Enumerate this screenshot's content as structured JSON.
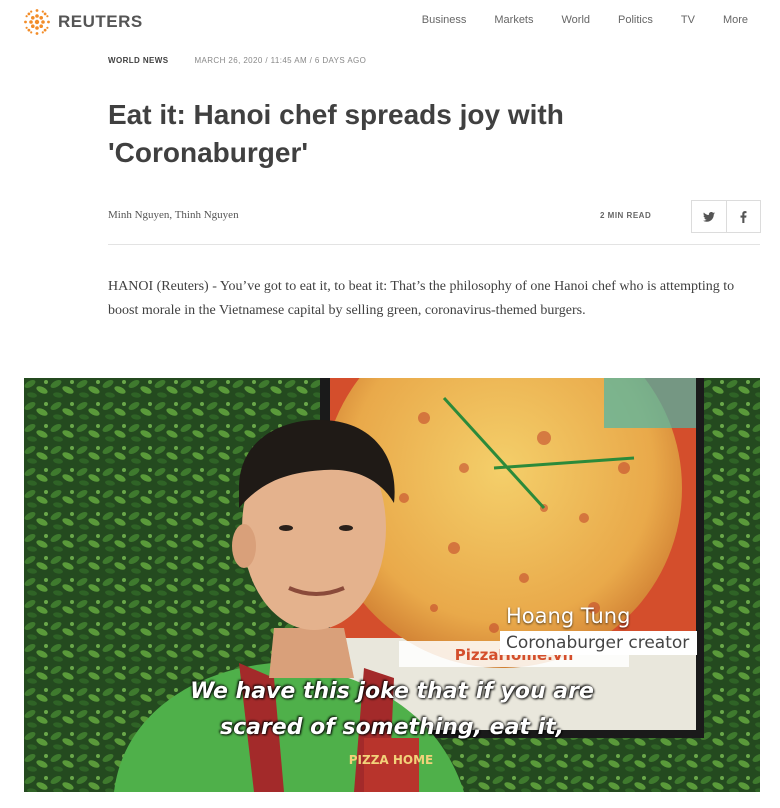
{
  "header": {
    "brand": "REUTERS",
    "nav": [
      "Business",
      "Markets",
      "World",
      "Politics",
      "TV",
      "More"
    ]
  },
  "article": {
    "section": "WORLD NEWS",
    "date": "MARCH 26, 2020 / 11:45 AM / 6 DAYS AGO",
    "headline": "Eat it: Hanoi chef spreads joy with 'Coronaburger'",
    "byline": "Minh Nguyen, Thinh Nguyen",
    "read_time": "2 MIN READ",
    "share": {
      "twitter_icon": "twitter-icon",
      "facebook_icon": "facebook-icon"
    },
    "body": "HANOI (Reuters) - You’ve got to eat it, to beat it: That’s the philosophy of one Hanoi chef who is attempting to boost morale in the Vietnamese capital by selling green, coronavirus-themed burgers."
  },
  "video": {
    "speaker_name": "Hoang Tung",
    "speaker_role": "Coronaburger creator",
    "subtitle_line1": "We have this joke that if you are",
    "subtitle_line2": "scared of something, eat it,",
    "sign_text": "PizzaHome.vn",
    "apron_text": "PIZZA HOME"
  },
  "colors": {
    "brand_orange": "#f28c28",
    "text": "#404040",
    "divider": "#e3e3e3"
  }
}
